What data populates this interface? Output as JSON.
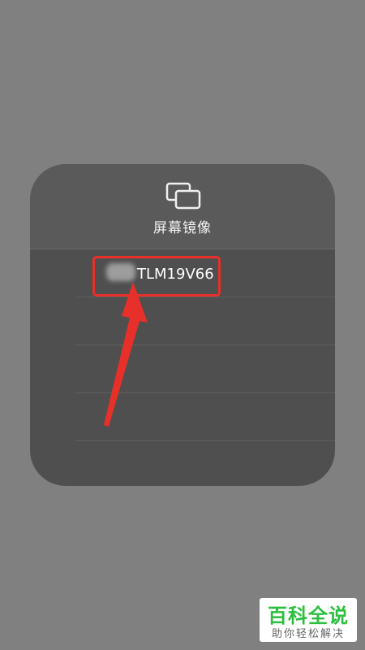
{
  "panel": {
    "title": "屏幕镜像",
    "icon": "screen-mirroring-icon"
  },
  "devices": [
    {
      "label": "TLM19V66",
      "blurred_prefix": "海信"
    },
    {
      "label": ""
    },
    {
      "label": ""
    },
    {
      "label": ""
    }
  ],
  "annotations": {
    "highlight_color": "#e8302a",
    "arrow_color": "#e8302a"
  },
  "watermark": {
    "title": "百科全说",
    "subtitle": "助你轻松解决",
    "color": "#2bbf3e"
  }
}
